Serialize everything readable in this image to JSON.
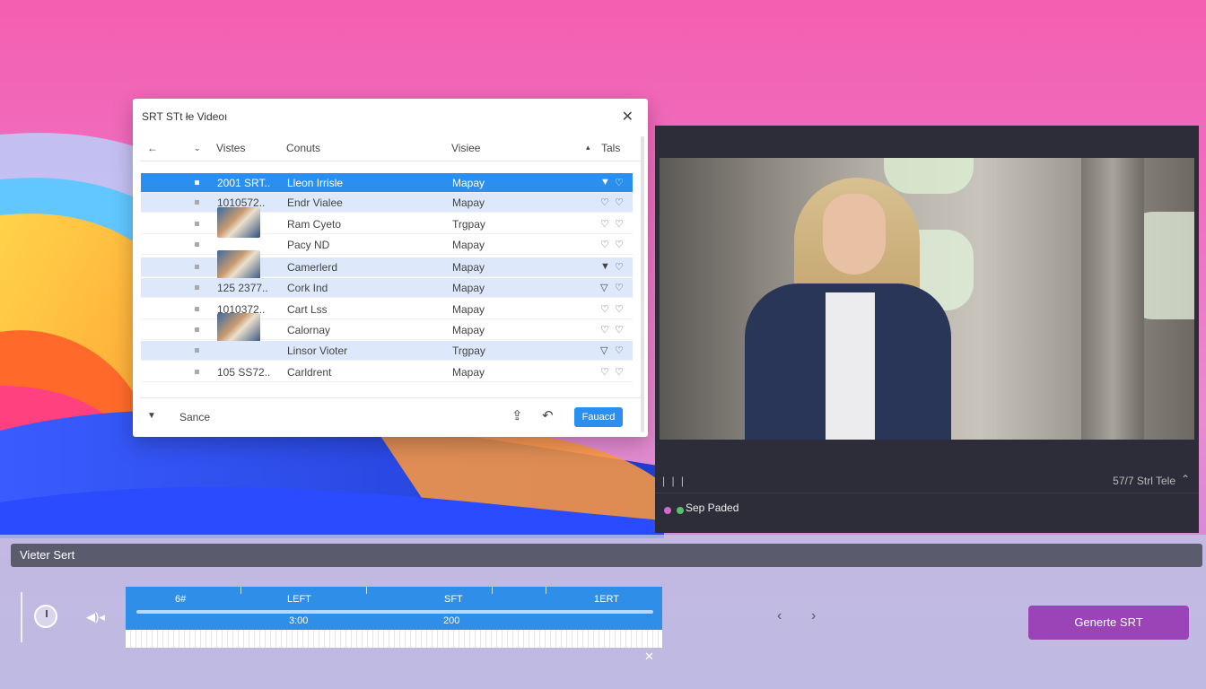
{
  "dialog": {
    "title": "SRT STt łe Videoı",
    "columns": [
      "Vistes",
      "Conuts",
      "Visiee",
      "Tals"
    ],
    "rows": [
      {
        "id": "2001 SRT..",
        "name": "Lleon Irrisle",
        "type": "Mapay",
        "thumb": false
      },
      {
        "id": "1010572..",
        "name": "Endr Vialee",
        "type": "Mapay",
        "thumb": false
      },
      {
        "id": "",
        "name": "Ram Cyeto",
        "type": "Trgpay",
        "thumb": true
      },
      {
        "id": "",
        "name": "Pacy ND",
        "type": "Mapay",
        "thumb": false
      },
      {
        "id": "",
        "name": "Camerlerd",
        "type": "Mapay",
        "thumb": true
      },
      {
        "id": "125 2377..",
        "name": "Cork Ind",
        "type": "Mapay",
        "thumb": false
      },
      {
        "id": "1010372..",
        "name": "Cart Lss",
        "type": "Mapay",
        "thumb": false
      },
      {
        "id": "",
        "name": "Calornay",
        "type": "Mapay",
        "thumb": true
      },
      {
        "id": "",
        "name": "Linsor Vioter",
        "type": "Trgpay",
        "thumb": false
      },
      {
        "id": "105 SS72..",
        "name": "Carldrent",
        "type": "Mapay",
        "thumb": false
      }
    ],
    "footer_label": "Sance",
    "footer_button": "Fauacd"
  },
  "player": {
    "status_right": "57/7 Strl Tele",
    "label": "Sep Paded",
    "dot_colors": [
      "#d46ac8",
      "#58c070"
    ]
  },
  "bottom": {
    "header": "Vieter Sert",
    "timeline_labels": [
      "6#",
      "LEFT",
      "SFT",
      "1ERT"
    ],
    "timeline_values": [
      "3:00",
      "200"
    ],
    "generate_button": "Generte SRT"
  },
  "colors": {
    "accent_blue": "#2b8ff0",
    "generate_purple": "#9a44b8"
  }
}
